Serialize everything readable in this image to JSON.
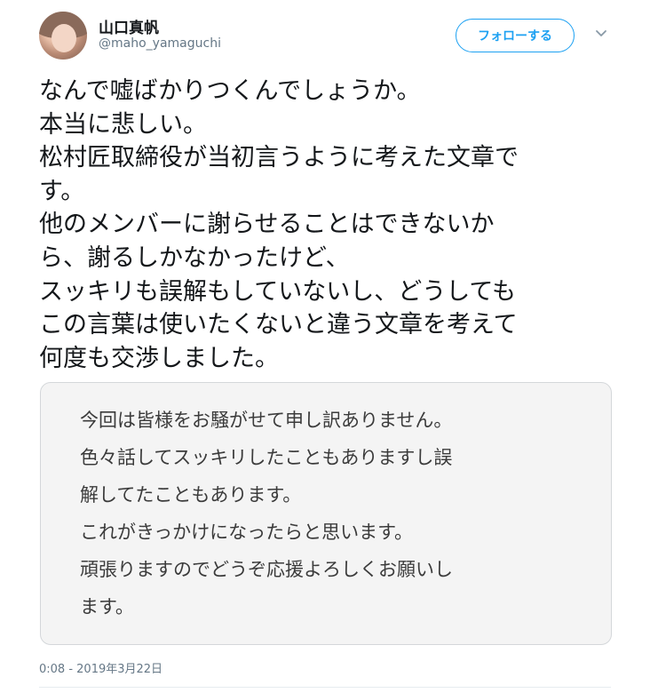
{
  "author": {
    "name": "山口真帆",
    "handle": "@maho_yamaguchi"
  },
  "follow_button": {
    "label": "フォローする"
  },
  "tweet_lines": [
    "なんで嘘ばかりつくんでしょうか。",
    "本当に悲しい。",
    "松村匠取締役が当初言うように考えた文章で",
    "す。",
    "他のメンバーに謝らせることはできないか",
    "ら、謝るしかなかったけど、",
    "スッキリも誤解もしていないし、どうしても",
    "この言葉は使いたくないと違う文章を考えて",
    "何度も交渉しました。"
  ],
  "image_text_lines": [
    "今回は皆様をお騒がせて申し訳ありません。",
    "色々話してスッキリしたこともありますし誤",
    "解してたこともあります。",
    "これがきっかけになったらと思います。",
    "頑張りますのでどうぞ応援よろしくお願いし",
    "ます。"
  ],
  "timestamp": "0:08 - 2019年3月22日",
  "colors": {
    "accent": "#1da1f2",
    "text": "#14171a",
    "secondary": "#657786",
    "card_background": "#f4f4f4"
  },
  "icons": [
    "avatar",
    "chevron-down-icon"
  ]
}
